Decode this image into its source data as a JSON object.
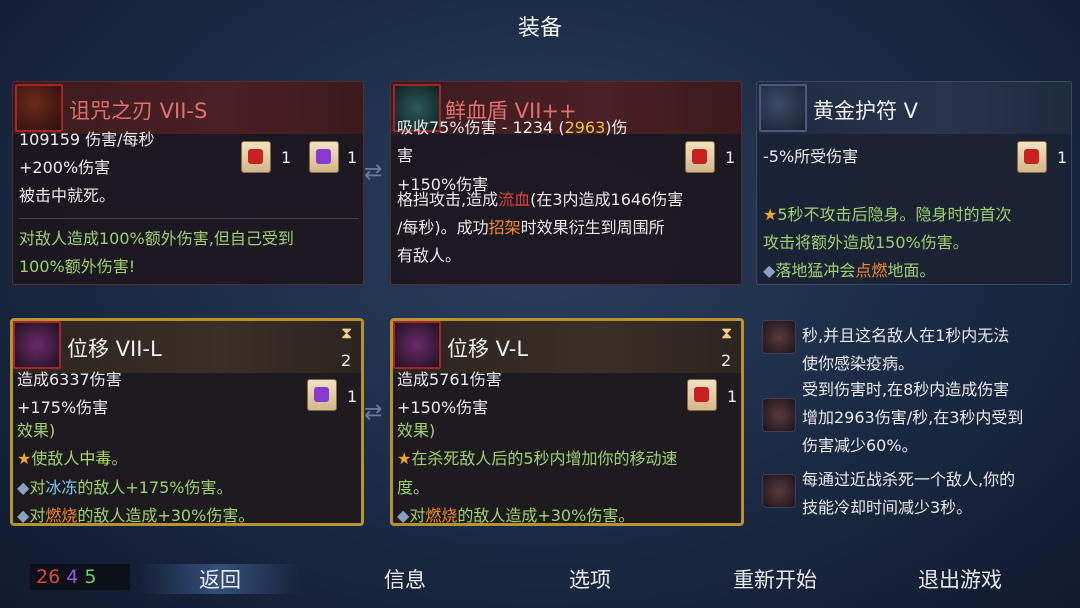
{
  "title": "装备",
  "cards": {
    "c1": {
      "name": "诅咒之刃 VII-S",
      "icon": "cursed-blade-icon",
      "line1": "109159 伤害/每秒",
      "line2": "+200%伤害",
      "line3": "被击中就死。",
      "effect1": "对敌人造成100%额外伤害,但自己受到",
      "effect2": "100%额外伤害!",
      "scroll_a_count": "1",
      "scroll_b_count": "1"
    },
    "c2": {
      "name": "鲜血盾 VII++",
      "icon": "blood-shield-icon",
      "line1_a": "吸收75%伤害 - 1234 (",
      "line1_b": "2963",
      "line1_c": ")伤",
      "line2": "害",
      "line3": "+150%伤害",
      "effect1_a": "格挡攻击,造成",
      "effect1_b": "流血",
      "effect1_c": "(在3内造成1646伤害",
      "effect2": "/每秒)。成功",
      "effect2_b": "招架",
      "effect2_c": "时效果衍生到周围所",
      "effect3": "有敌人。",
      "scroll_count": "1"
    },
    "c3": {
      "name": "黄金护符 V",
      "icon": "golden-amulet-icon",
      "line1": "-5%所受伤害",
      "effect1": "5秒不攻击后隐身。隐身时的首次",
      "effect2": "攻击将额外造成150%伤害。",
      "effect3_a": "落地猛冲会",
      "effect3_b": "点燃",
      "effect3_c": "地面。",
      "scroll_count": "1"
    },
    "c4": {
      "name": "位移 VII-L",
      "icon": "dash-icon",
      "cooldown": "2",
      "line1": "造成6337伤害",
      "line2": "+175%伤害",
      "line3": "效果)",
      "effect1_a": "使敌人",
      "effect1_b": "中毒",
      "effect1_c": "。",
      "effect2_a": "对",
      "effect2_b": "冰冻",
      "effect2_c": "的敌人+175%伤害。",
      "effect3_a": "对",
      "effect3_b": "燃烧",
      "effect3_c": "的敌人造成+30%伤害。",
      "scroll_count": "1"
    },
    "c5": {
      "name": "位移 V-L",
      "icon": "dash-icon",
      "cooldown": "2",
      "line1": "造成5761伤害",
      "line2": "+150%伤害",
      "line3": "效果)",
      "effect1": "在杀死敌人后的5秒内增加你的移动速",
      "effect2": "度。",
      "effect3_a": "对",
      "effect3_b": "燃烧",
      "effect3_c": "的敌人造成+30%伤害。",
      "scroll_count": "1"
    }
  },
  "perks": [
    {
      "icon": "plague-sword-icon",
      "l1": "秒,并且这名敌人在1秒内无法",
      "l2": "使你感染疫病。"
    },
    {
      "icon": "spiked-shield-icon",
      "l1": "受到伤害时,在8秒内造成伤害",
      "l2": "增加2963伤害/秒,在3秒内受到",
      "l3": "伤害减少60%。"
    },
    {
      "icon": "sword-icon",
      "l1": "每通过近战杀死一个敌人,你的",
      "l2": "技能冷却时间减少3秒。"
    }
  ],
  "stats": {
    "red": "26",
    "purple": "4",
    "green": "5"
  },
  "nav": {
    "back": "返回",
    "info": "信息",
    "options": "选项",
    "restart": "重新开始",
    "quit": "退出游戏"
  },
  "colors": {
    "brutality": "#e2453a",
    "tactics": "#9a5ae0",
    "survival": "#6ad06a"
  }
}
